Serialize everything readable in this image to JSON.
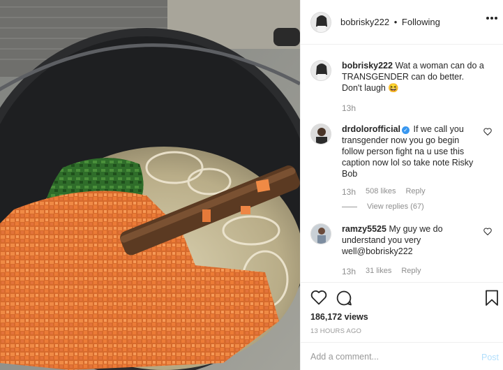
{
  "post": {
    "username": "bobrisky222",
    "separator": "•",
    "follow_status": "Following",
    "caption": "Wat a woman can do a TRANSGENDER can do better. Don't laugh 😆",
    "caption_time": "13h"
  },
  "comments": [
    {
      "username": "drdolorofficial",
      "verified": true,
      "text": "If we call you transgender now you go begin follow person fight na u use this caption now lol so take note Risky Bob",
      "time": "13h",
      "likes": "508 likes",
      "reply_label": "Reply",
      "view_replies": "View replies (67)"
    },
    {
      "username": "ramzy5525",
      "verified": false,
      "text": "My guy we do understand you very well@bobrisky222",
      "time": "13h",
      "likes": "31 likes",
      "reply_label": "Reply"
    }
  ],
  "stats": {
    "views": "186,172 views",
    "posted_ago": "13 HOURS AGO"
  },
  "composer": {
    "placeholder": "Add a comment...",
    "post_label": "Post"
  },
  "icons": {
    "like": "heart-icon",
    "comment": "comment-bubble-icon",
    "save": "bookmark-icon",
    "more": "more-options-icon",
    "verified": "verified-badge-icon"
  },
  "colors": {
    "link_blue": "#3897f0",
    "post_disabled": "#b2dffc",
    "muted_text": "#8e8e8e"
  }
}
